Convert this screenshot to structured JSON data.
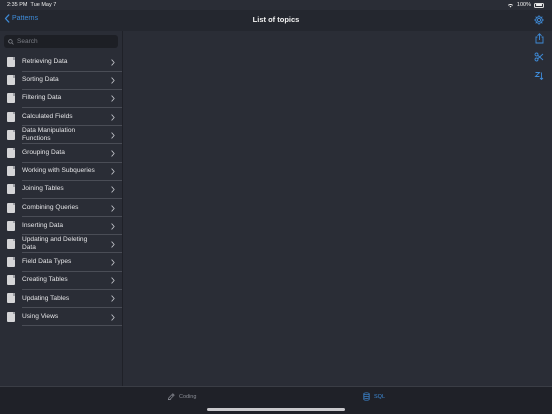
{
  "status": {
    "time": "2:35 PM",
    "date": "Tue May 7",
    "battery": "100%"
  },
  "nav": {
    "back_label": "Patterns",
    "title": "List of topics"
  },
  "search": {
    "placeholder": "Search"
  },
  "topics": [
    "Retrieving Data",
    "Sorting Data",
    "Filtering Data",
    "Calculated Fields",
    "Data Manipulation Functions",
    "Grouping Data",
    "Working with Subqueries",
    "Joining Tables",
    "Combining Queries",
    "Inserting Data",
    "Updating and Deleting Data",
    "Field Data Types",
    "Creating Tables",
    "Updating Tables",
    "Using Views"
  ],
  "tabs": {
    "coding": "Coding",
    "sql": "SQL"
  },
  "colors": {
    "accent": "#3e8bd8",
    "background": "#2a2d36",
    "bar": "#24272f"
  },
  "icons": [
    "chevron-left-icon",
    "gear-icon",
    "search-icon",
    "document-icon",
    "chevron-right-icon",
    "share-icon",
    "scissors-icon",
    "sort-icon",
    "pencil-icon",
    "database-icon"
  ]
}
